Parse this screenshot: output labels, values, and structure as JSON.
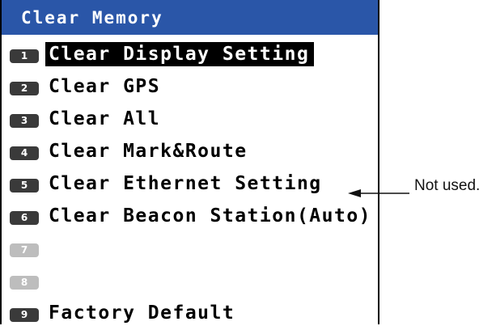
{
  "screen": {
    "title": "Clear Memory"
  },
  "menu": {
    "items": [
      {
        "num": "1",
        "label": "Clear Display Setting",
        "selected": true,
        "enabled": true
      },
      {
        "num": "2",
        "label": "Clear GPS",
        "selected": false,
        "enabled": true
      },
      {
        "num": "3",
        "label": "Clear All",
        "selected": false,
        "enabled": true
      },
      {
        "num": "4",
        "label": "Clear Mark&Route",
        "selected": false,
        "enabled": true
      },
      {
        "num": "5",
        "label": "Clear Ethernet Setting",
        "selected": false,
        "enabled": true
      },
      {
        "num": "6",
        "label": "Clear Beacon Station(Auto)",
        "selected": false,
        "enabled": true
      },
      {
        "num": "7",
        "label": "",
        "selected": false,
        "enabled": false
      },
      {
        "num": "8",
        "label": "",
        "selected": false,
        "enabled": false
      },
      {
        "num": "9",
        "label": "Factory Default",
        "selected": false,
        "enabled": true
      }
    ]
  },
  "annotation": {
    "text": "Not used."
  },
  "colors": {
    "title_bar": "#2a56a8",
    "selected_bg": "#000000",
    "key_badge": "#3a3a3a",
    "key_badge_disabled": "#bdbdbd"
  }
}
